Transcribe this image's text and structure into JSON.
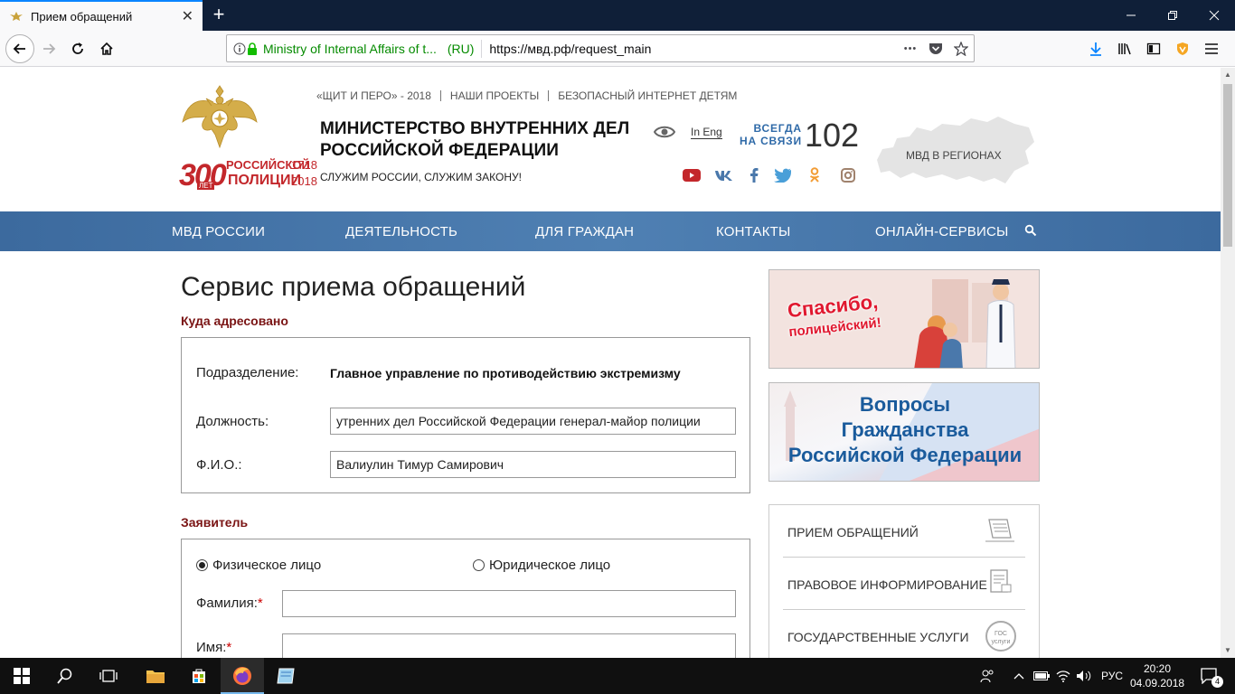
{
  "browser": {
    "tab_title": "Прием обращений",
    "tab_close": "✕",
    "new_tab": "+",
    "identity": "Ministry of Internal Affairs of t...",
    "identity_country": "(RU)",
    "url": "https://мвд.рф/request_main",
    "page_actions": "•••"
  },
  "site": {
    "top_links": [
      "«ЩИТ И ПЕРО» - 2018",
      "НАШИ ПРОЕКТЫ",
      "БЕЗОПАСНЫЙ ИНТЕРНЕТ ДЕТЯМ"
    ],
    "title_line1": "МИНИСТЕРСТВО ВНУТРЕННИХ ДЕЛ",
    "title_line2": "РОССИЙСКОЙ ФЕДЕРАЦИИ",
    "slogan": "СЛУЖИМ РОССИИ, СЛУЖИМ ЗАКОНУ!",
    "anniversary": {
      "big": "300",
      "small": "ЛЕТ",
      "line1": "РОССИЙСКОЙ",
      "line2": "ПОЛИЦИИ",
      "year1": "1718",
      "year2": "2018"
    },
    "lang_link": "In Eng",
    "always_line1": "ВСЕГДА",
    "always_line2": "НА СВЯЗИ",
    "phone": "102",
    "regions": "МВД В РЕГИОНАХ",
    "social_icons": [
      "youtube-icon",
      "vk-icon",
      "facebook-icon",
      "twitter-icon",
      "odnoklassniki-icon",
      "instagram-icon"
    ]
  },
  "main_nav": [
    "МВД РОССИИ",
    "ДЕЯТЕЛЬНОСТЬ",
    "ДЛЯ ГРАЖДАН",
    "КОНТАКТЫ",
    "ОНЛАЙН-СЕРВИСЫ"
  ],
  "form": {
    "page_title": "Сервис приема обращений",
    "addressee_label": "Куда адресовано",
    "subdivision_label": "Подразделение:",
    "subdivision_value": "Главное управление по противодействию экстремизму",
    "position_label": "Должность:",
    "position_value": "утренних дел Российской Федерации генерал-майор полиции",
    "fio_label": "Ф.И.О.:",
    "fio_value": "Валиулин Тимур Самирович",
    "applicant_label": "Заявитель",
    "radio_individual": "Физическое лицо",
    "radio_legal": "Юридическое лицо",
    "surname_label": "Фамилия:",
    "name_label": "Имя:",
    "required_mark": "*",
    "surname_value": "",
    "name_value": ""
  },
  "banners": {
    "thanks_line1": "Спасибо,",
    "thanks_line2": "полицейский!",
    "citizenship_line1": "Вопросы",
    "citizenship_line2": "Гражданства",
    "citizenship_line3": "Российской Федерации"
  },
  "side_menu": [
    "ПРИЕМ ОБРАЩЕНИЙ",
    "ПРАВОВОЕ ИНФОРМИРОВАНИЕ",
    "ГОСУДАРСТВЕННЫЕ УСЛУГИ"
  ],
  "side_menu_gos_badge": {
    "line1": "ГОС",
    "line2": "услуги"
  },
  "taskbar": {
    "lang": "РУС",
    "time": "20:20",
    "date": "04.09.2018",
    "notifications": "4"
  },
  "colors": {
    "nav_blue": "#4a78ab",
    "section_red": "#7a1414",
    "accent_blue": "#2f6aa8"
  }
}
